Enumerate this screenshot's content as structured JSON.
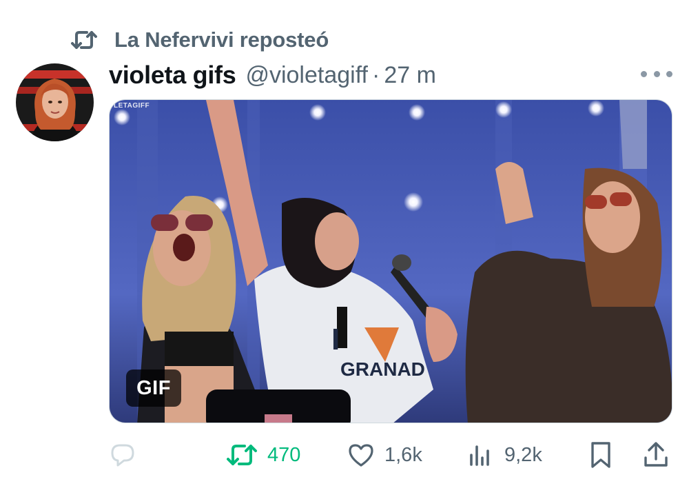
{
  "repost_banner": {
    "text": "La Nefervivi reposteó",
    "icon": "repost-icon"
  },
  "tweet": {
    "display_name": "violeta gifs",
    "handle": "@violetagiff",
    "separator": "·",
    "time": "27 m",
    "media": {
      "badge": "GIF",
      "watermark": "LETAGIFF",
      "shirt_text": "GRANAD",
      "shirt_letter": "I"
    }
  },
  "actions": {
    "reply": {
      "icon": "reply-icon",
      "count": ""
    },
    "repost": {
      "icon": "repost-icon",
      "count": "470",
      "color": "#00ba7c"
    },
    "like": {
      "icon": "heart-icon",
      "count": "1,6k"
    },
    "views": {
      "icon": "views-icon",
      "count": "9,2k"
    },
    "bookmark": {
      "icon": "bookmark-icon"
    },
    "share": {
      "icon": "share-icon"
    }
  },
  "colors": {
    "secondary_text": "#536471",
    "primary_text": "#0f1419",
    "repost_active": "#00ba7c",
    "more_dots": "#8b98a5"
  }
}
